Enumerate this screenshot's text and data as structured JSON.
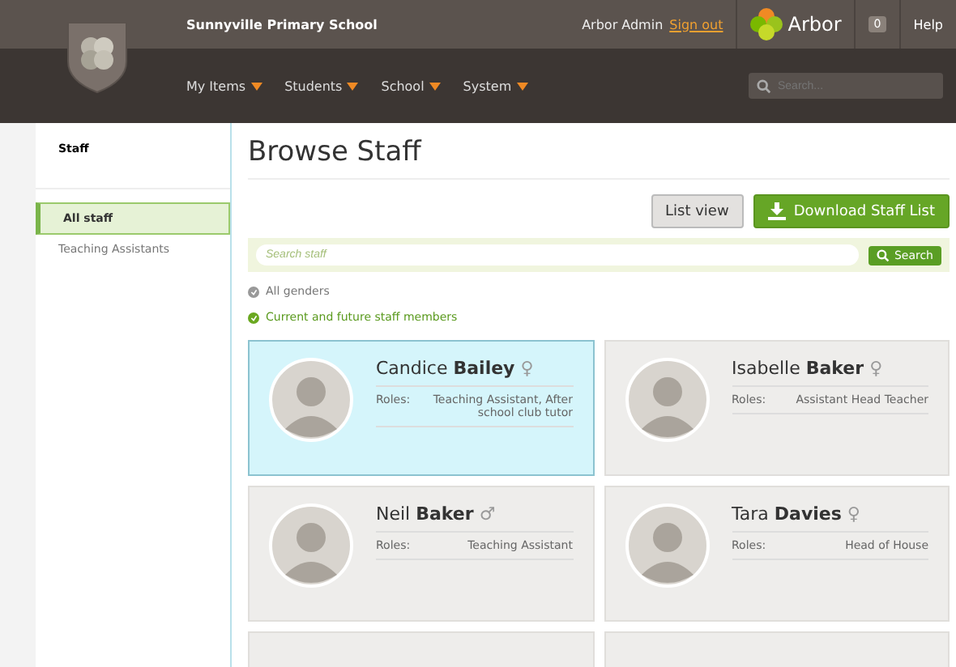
{
  "header": {
    "school": "Sunnyville Primary School",
    "user": "Arbor Admin",
    "sign_out": "Sign out",
    "brand": "Arbor",
    "notifications": "0",
    "help": "Help"
  },
  "nav": {
    "items": [
      "My Items",
      "Students",
      "School",
      "System"
    ],
    "search_placeholder": "Search..."
  },
  "sidebar": {
    "title": "Staff",
    "items": [
      {
        "label": "All staff",
        "selected": true
      },
      {
        "label": "Teaching Assistants",
        "selected": false
      }
    ]
  },
  "main": {
    "title": "Browse Staff",
    "buttons": [
      {
        "label": "List view",
        "kind": "plain"
      },
      {
        "label": "Download Staff List",
        "kind": "download"
      }
    ],
    "search": {
      "placeholder": "Search staff",
      "button": "Search"
    },
    "filters": [
      {
        "label": "All genders",
        "selected": false
      },
      {
        "label": "Current and future staff members",
        "selected": true
      }
    ],
    "staff": [
      {
        "first": "Candice",
        "last": "Bailey",
        "symbol": "♀",
        "roles_label": "Roles:",
        "roles": "Teaching Assistant, After school club tutor",
        "selected": true
      },
      {
        "first": "Isabelle",
        "last": "Baker",
        "symbol": "♀",
        "roles_label": "Roles:",
        "roles": "Assistant Head Teacher",
        "selected": false
      },
      {
        "first": "Neil",
        "last": "Baker",
        "symbol": "♂",
        "roles_label": "Roles:",
        "roles": "Teaching Assistant",
        "selected": false
      },
      {
        "first": "Tara",
        "last": "Davies",
        "symbol": "♀",
        "roles_label": "Roles:",
        "roles": "Head of House",
        "selected": false
      }
    ]
  }
}
